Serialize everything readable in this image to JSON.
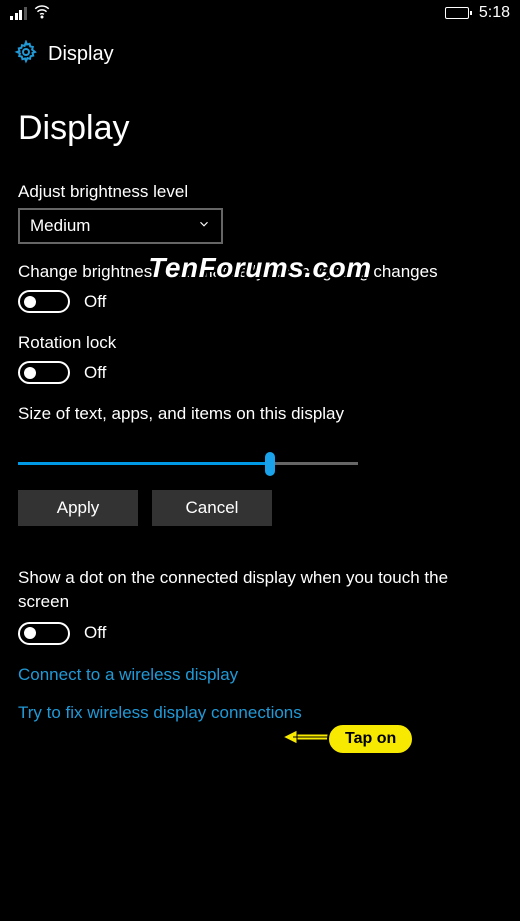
{
  "status": {
    "time": "5:18"
  },
  "header": {
    "title": "Display"
  },
  "page": {
    "title": "Display"
  },
  "brightness": {
    "label": "Adjust brightness level",
    "value": "Medium"
  },
  "auto_brightness": {
    "label": "Change brightness automatically when lighting changes",
    "state": "Off"
  },
  "rotation_lock": {
    "label": "Rotation lock",
    "state": "Off"
  },
  "scaling": {
    "label": "Size of text, apps, and items on this display",
    "apply": "Apply",
    "cancel": "Cancel"
  },
  "show_dot": {
    "label": "Show a dot on the connected display when you touch the screen",
    "state": "Off"
  },
  "links": {
    "connect": "Connect to a wireless display",
    "fix": "Try to fix wireless display connections"
  },
  "annotation": {
    "text": "Tap on"
  },
  "watermark": "TenForums.com"
}
